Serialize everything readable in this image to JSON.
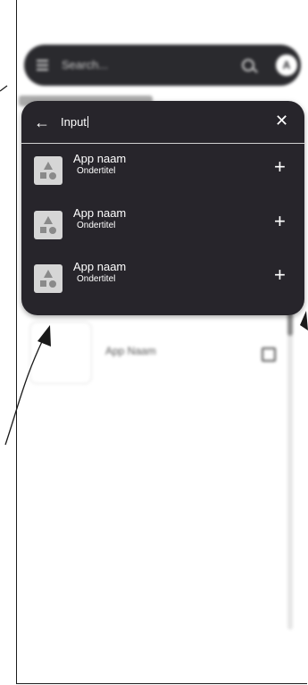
{
  "background": {
    "search": {
      "placeholder": "Search...",
      "avatar_initial": "A"
    },
    "app_card": {
      "name": "App Naam"
    }
  },
  "search_panel": {
    "input_value": "Input",
    "results": [
      {
        "title": "App naam",
        "subtitle": "Ondertitel"
      },
      {
        "title": "App naam",
        "subtitle": "Ondertitel"
      },
      {
        "title": "App naam",
        "subtitle": "Ondertitel"
      }
    ]
  },
  "icons": {
    "back": "arrow-left",
    "close": "x",
    "add": "plus",
    "placeholder_thumb": "shapes",
    "menu": "hamburger",
    "search": "magnifier"
  },
  "colors": {
    "panel_bg": "#27252b",
    "searchbar_bg": "#2a2a2e",
    "thumb_bg": "#d6d6d6"
  }
}
